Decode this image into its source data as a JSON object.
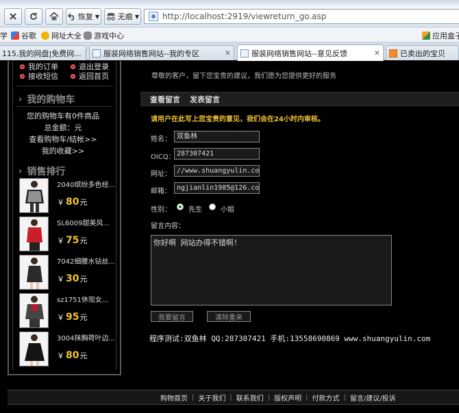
{
  "browser": {
    "back_label": "恢复",
    "tracking_label": "无痕",
    "address": "http://localhost:2919/viewreturn_go.asp",
    "favorites": [
      "学",
      "谷歌",
      "网址大全",
      "游戏中心"
    ],
    "right_fav": "应用盒子",
    "tabs": [
      {
        "label": "115,我的网盘|免费网..."
      },
      {
        "label": "服装网络销售网站--我的专区"
      },
      {
        "label": "服装网络销售网站--意见反馈"
      },
      {
        "label": "已卖出的宝贝"
      }
    ]
  },
  "sidebar": {
    "menu": [
      {
        "label": "我的订单"
      },
      {
        "label": "退出登录"
      },
      {
        "label": "接收短信"
      },
      {
        "label": "返回首页"
      }
    ],
    "cart_title": "我的购物车",
    "cart_count": "您的购物车有0件商品",
    "cart_total": "总金额：元",
    "cart_view": "查看购物车/结帐>>",
    "favorites": "我的收藏>>",
    "rank_title": "销售排行",
    "yen": "￥",
    "yuan": "元",
    "rank": [
      {
        "name": "2040缤纷多色经...",
        "price": "80"
      },
      {
        "name": "SL6009甜美风...",
        "price": "75"
      },
      {
        "name": "7042细腰水钻丝...",
        "price": "30"
      },
      {
        "name": "sz1751休现女...",
        "price": "95"
      },
      {
        "name": "3004抹胸荷叶边...",
        "price": "80"
      }
    ]
  },
  "main": {
    "welcome": "尊敬的客户，留下您宝贵的建议，我们愿为您提供更好的服务",
    "tab_view": "查看留言",
    "tab_post": "发表留言",
    "notice": "请用户在此写上您宝贵的意见，我们会在24小时内审核。",
    "form": {
      "name_label": "姓名：",
      "name_value": "双鱼林",
      "oicq_label": "OICQ：",
      "oicq_value": "287307421",
      "url_label": "网址：",
      "url_value": "//www.shuangyulin.com",
      "email_label": "邮箱：",
      "email_value": "ngjianlin1985@126.com",
      "gender_label": "性别：",
      "male": "先生",
      "female": "小姐",
      "message_label": "留言内容：",
      "message_value": "你好啊 网站办得不错啊!",
      "submit": "我要留言",
      "reset": "清除重来"
    },
    "credit": "程序测试:双鱼林 QQ:287307421 手机:13558690869 www.shuangyulin.com"
  },
  "footer": [
    "购物首页",
    "关于我们",
    "联系我们",
    "版权声明",
    "付款方式",
    "留言/建议/投诉"
  ]
}
